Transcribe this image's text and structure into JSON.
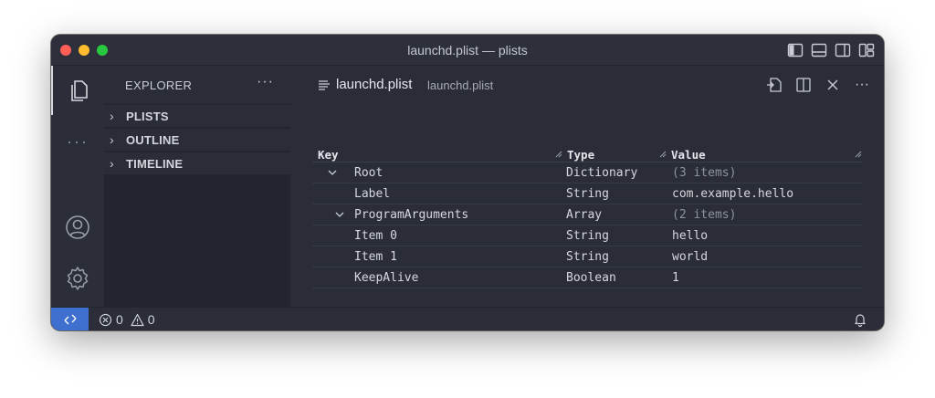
{
  "window": {
    "title": "launchd.plist — plists"
  },
  "sidebar": {
    "title": "EXPLORER",
    "more": "···",
    "sections": [
      {
        "label": "PLISTS"
      },
      {
        "label": "OUTLINE"
      },
      {
        "label": "TIMELINE"
      }
    ]
  },
  "editor": {
    "tab_name": "launchd.plist",
    "tab_desc": "launchd.plist",
    "more": "···"
  },
  "grid": {
    "headers": {
      "key": "Key",
      "type": "Type",
      "value": "Value"
    },
    "rows": [
      {
        "key": "Root",
        "type": "Dictionary",
        "value": "(3 items)"
      },
      {
        "key": "Label",
        "type": "String",
        "value": "com.example.hello"
      },
      {
        "key": "ProgramArguments",
        "type": "Array",
        "value": "(2 items)"
      },
      {
        "key": "Item 0",
        "type": "String",
        "value": "hello"
      },
      {
        "key": "Item 1",
        "type": "String",
        "value": "world"
      },
      {
        "key": "KeepAlive",
        "type": "Boolean",
        "value": "1"
      }
    ]
  },
  "status": {
    "errors": "0",
    "warnings": "0"
  },
  "colors": {
    "accent": "#3f6fcf",
    "background": "#2a2d37",
    "sidebar": "#22252d"
  }
}
